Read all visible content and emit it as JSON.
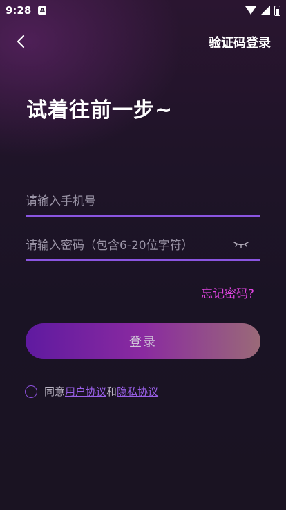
{
  "status_bar": {
    "time": "9:28",
    "notification_badge": "A"
  },
  "header": {
    "back_icon": "chevron-left-icon",
    "code_login_label": "验证码登录"
  },
  "headline": "试着往前一步~",
  "form": {
    "phone_placeholder": "请输入手机号",
    "password_placeholder": "请输入密码（包含6-20位字符）",
    "eye_icon": "eye-closed-icon",
    "forgot_label": "忘记密码?",
    "login_label": "登录"
  },
  "agreement": {
    "prefix": "同意",
    "user_agreement": "用户协议",
    "and": "和",
    "privacy_agreement": "隐私协议"
  },
  "colors": {
    "underline": "#8a55e0",
    "link_pink": "#e045e0",
    "button_start": "#5f1aa0",
    "button_end": "#9a6a78"
  }
}
